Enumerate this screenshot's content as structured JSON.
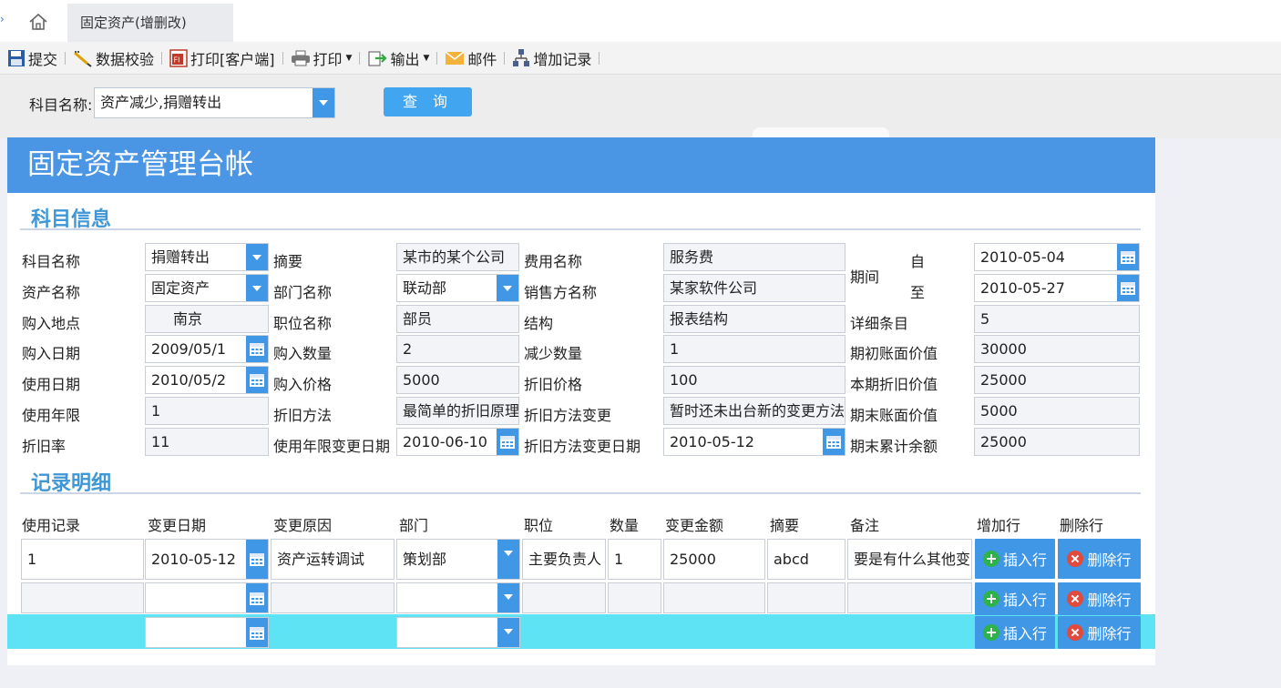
{
  "tab": {
    "title": "固定资产(增删改)"
  },
  "toolbar": {
    "submit": "提交",
    "validate": "数据校验",
    "print_client": "打印[客户端]",
    "print": "打印",
    "export": "输出",
    "mail": "邮件",
    "add_record": "增加记录"
  },
  "query": {
    "label": "科目名称:",
    "value": "资产减少,捐赠转出",
    "button": "查 询"
  },
  "report": {
    "title": "固定资产管理台帐"
  },
  "section1": {
    "title": "科目信息",
    "labels": {
      "subject_name": "科目名称",
      "asset_name": "资产名称",
      "purchase_place": "购入地点",
      "purchase_date": "购入日期",
      "use_date": "使用日期",
      "use_years": "使用年限",
      "depr_rate": "折旧率",
      "summary": "摘要",
      "dept_name": "部门名称",
      "position_name": "职位名称",
      "purchase_qty": "购入数量",
      "purchase_price": "购入价格",
      "depr_method": "折旧方法",
      "years_change_date": "使用年限变更日期",
      "fee_name": "费用名称",
      "seller_name": "销售方名称",
      "structure": "结构",
      "decrease_qty": "减少数量",
      "depr_price": "折旧价格",
      "depr_method_change": "折旧方法变更",
      "depr_method_change_date": "折旧方法变更日期",
      "period": "期间",
      "from": "自",
      "to": "至",
      "detail_count": "详细条目",
      "opening_book_value": "期初账面价值",
      "current_depr_value": "本期折旧价值",
      "closing_book_value": "期末账面价值",
      "closing_accum_balance": "期末累计余额"
    },
    "values": {
      "subject_name": "捐赠转出",
      "asset_name": "固定资产",
      "purchase_place": "南京",
      "purchase_date": "2009/05/1",
      "use_date": "2010/05/2",
      "use_years": "1",
      "depr_rate": "11",
      "summary": "某市的某个公司",
      "dept_name": "联动部",
      "position_name": "部员",
      "purchase_qty": "2",
      "purchase_price": "5000",
      "depr_method": "最简单的折旧原理",
      "years_change_date": "2010-06-10",
      "fee_name": "服务费",
      "seller_name": "某家软件公司",
      "structure": "报表结构",
      "decrease_qty": "1",
      "depr_price": "100",
      "depr_method_change": "暂时还未出台新的变更方法",
      "depr_method_change_date": "2010-05-12",
      "period_from": "2010-05-04",
      "period_to": "2010-05-27",
      "detail_count": "5",
      "opening_book_value": "30000",
      "current_depr_value": "25000",
      "closing_book_value": "5000",
      "closing_accum_balance": "25000"
    }
  },
  "section2": {
    "title": "记录明细",
    "columns": [
      "使用记录",
      "变更日期",
      "变更原因",
      "部门",
      "职位",
      "数量",
      "变更金额",
      "摘要",
      "备注",
      "增加行",
      "删除行"
    ],
    "rows": [
      {
        "record": "1",
        "date": "2010-05-12",
        "reason": "资产运转调试",
        "dept": "策划部",
        "position": "主要负责人",
        "qty": "1",
        "amount": "25000",
        "summary": "abcd",
        "remark": "要是有什么其他变"
      },
      {
        "record": "",
        "date": "",
        "reason": "",
        "dept": "",
        "position": "",
        "qty": "",
        "amount": "",
        "summary": "",
        "remark": ""
      },
      {
        "record": "",
        "date": "",
        "reason": "",
        "dept": "",
        "position": "",
        "qty": "",
        "amount": "",
        "summary": "",
        "remark": ""
      }
    ],
    "insert_label": "插入行",
    "delete_label": "删除行"
  },
  "colors": {
    "accent": "#3f97e6",
    "banner": "#4a95e4",
    "section_title": "#3f97d6",
    "highlight_row": "#5ee3f4"
  },
  "icons": [
    "home-icon",
    "save-icon",
    "validate-icon",
    "pdf-icon",
    "printer-icon",
    "export-icon",
    "mail-icon",
    "add-record-icon",
    "calendar-icon",
    "plus-icon",
    "delete-icon"
  ]
}
